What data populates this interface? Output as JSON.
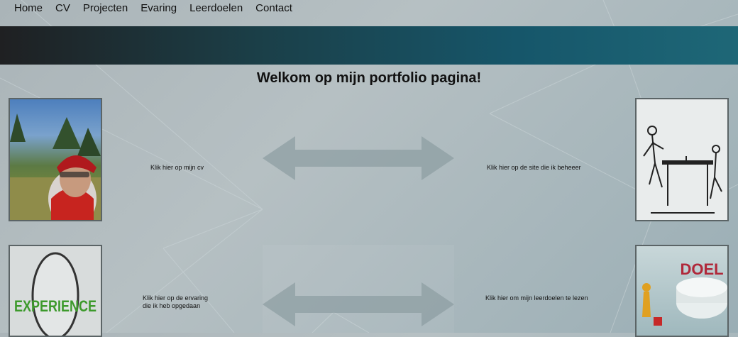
{
  "nav": {
    "items": [
      "Home",
      "CV",
      "Projecten",
      "Evaring",
      "Leerdoelen",
      "Contact"
    ]
  },
  "main": {
    "title": "Welkom op mijn portfolio pagina!",
    "links": {
      "cv": "Klik hier op mijn cv",
      "site": "Klik hier op de site die ik beheeer",
      "experience_line1": "Klik hier op de ervaring",
      "experience_line2": "die ik heb opgedaan",
      "goals": "Klik hier om mijn leerdoelen te lezen"
    },
    "images": {
      "experience_word": "EXPERIENCE",
      "doel_word": "DOEL"
    }
  },
  "colors": {
    "banner_start": "#1f2022",
    "banner_end": "#1e6777",
    "background": "#aab4b8",
    "arrow": "#8c9ca1"
  },
  "icons": {
    "arrow_double": "double-arrow-icon"
  }
}
